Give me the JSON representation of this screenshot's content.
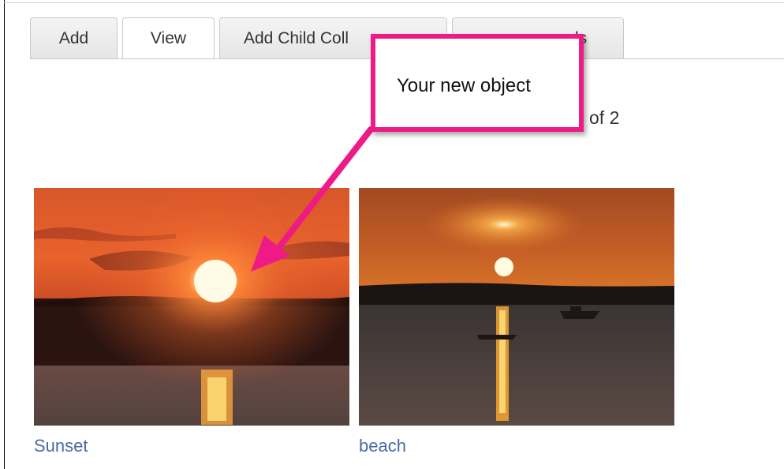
{
  "tabs": [
    {
      "label": "Add",
      "active": false
    },
    {
      "label": "View",
      "active": true
    },
    {
      "label": "Add Child Coll",
      "active": false
    },
    {
      "label": "ls",
      "active": false
    }
  ],
  "pager": {
    "text": "of 2"
  },
  "callout": {
    "text": "Your new object",
    "color": "#ee1b86"
  },
  "items": [
    {
      "caption": "Sunset",
      "image": "sunset-photo"
    },
    {
      "caption": "beach",
      "image": "beach-photo"
    }
  ],
  "colors": {
    "link": "#4a6aa5",
    "callout": "#ee1b86"
  }
}
